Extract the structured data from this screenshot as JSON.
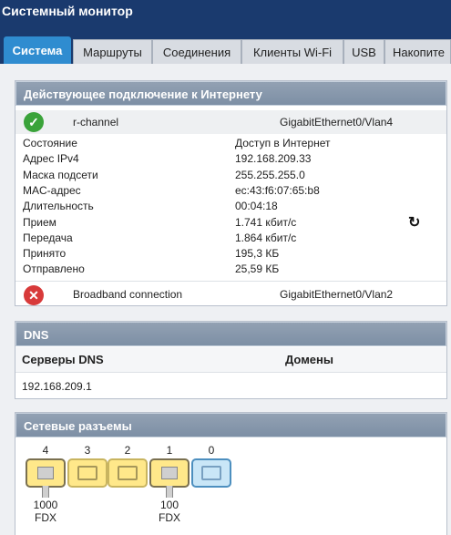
{
  "app": {
    "title": "Системный монитор"
  },
  "tabs": [
    {
      "label": "Система"
    },
    {
      "label": "Маршруты"
    },
    {
      "label": "Соединения"
    },
    {
      "label": "Клиенты Wi-Fi"
    },
    {
      "label": "USB"
    },
    {
      "label": "Накопите"
    }
  ],
  "internet": {
    "title": "Действующее подключение к Интернету",
    "primary": {
      "name": "r-channel",
      "interface": "GigabitEthernet0/Vlan4",
      "status_icon": "check-icon"
    },
    "details": [
      {
        "key": "Состояние",
        "value": "Доступ в Интернет"
      },
      {
        "key": "Адрес IPv4",
        "value": "192.168.209.33"
      },
      {
        "key": "Маска подсети",
        "value": "255.255.255.0"
      },
      {
        "key": "MAC-адрес",
        "value": "ec:43:f6:07:65:b8"
      },
      {
        "key": "Длительность",
        "value": "00:04:18"
      },
      {
        "key": "Прием",
        "value": "1.741 кбит/с"
      },
      {
        "key": "Передача",
        "value": "1.864 кбит/с"
      },
      {
        "key": "Принято",
        "value": "195,3 КБ"
      },
      {
        "key": "Отправлено",
        "value": "25,59 КБ"
      }
    ],
    "secondary": {
      "name": "Broadband connection",
      "interface": "GigabitEthernet0/Vlan2",
      "status_icon": "cross-icon"
    }
  },
  "dns": {
    "title": "DNS",
    "col_servers": "Серверы DNS",
    "col_domains": "Домены",
    "servers": [
      "192.168.209.1"
    ]
  },
  "ports": {
    "title": "Сетевые разъемы",
    "items": [
      {
        "num": "4",
        "connected": true,
        "speed": "1000",
        "duplex": "FDX"
      },
      {
        "num": "3",
        "connected": false
      },
      {
        "num": "2",
        "connected": false
      },
      {
        "num": "1",
        "connected": true,
        "speed": "100",
        "duplex": "FDX"
      },
      {
        "num": "0",
        "connected": false,
        "type": "wan"
      }
    ]
  },
  "colors": {
    "active_tab": "#2f8cd0",
    "header": "#1a3a6e",
    "ok": "#3aa33a",
    "error": "#d83a3a"
  }
}
